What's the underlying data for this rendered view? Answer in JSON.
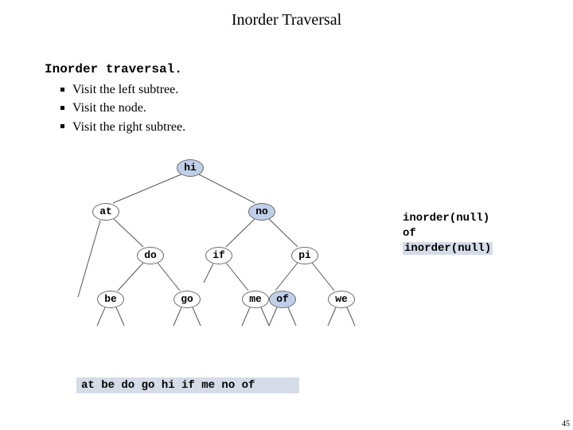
{
  "title": "Inorder Traversal",
  "heading": "Inorder traversal.",
  "bullets": [
    "Visit the left subtree.",
    "Visit the node.",
    "Visit the right subtree."
  ],
  "tree": {
    "nodes": {
      "hi": "hi",
      "at": "at",
      "no": "no",
      "do": "do",
      "if": "if",
      "pi": "pi",
      "be": "be",
      "go": "go",
      "me": "me",
      "of": "of",
      "we": "we"
    },
    "highlighted": [
      "hi",
      "no",
      "of"
    ]
  },
  "sidecode": {
    "line1": "inorder(null)",
    "line2": "of",
    "line3": "inorder(null)"
  },
  "output_sequence": "at be do go hi if me no of",
  "page_number": "45"
}
